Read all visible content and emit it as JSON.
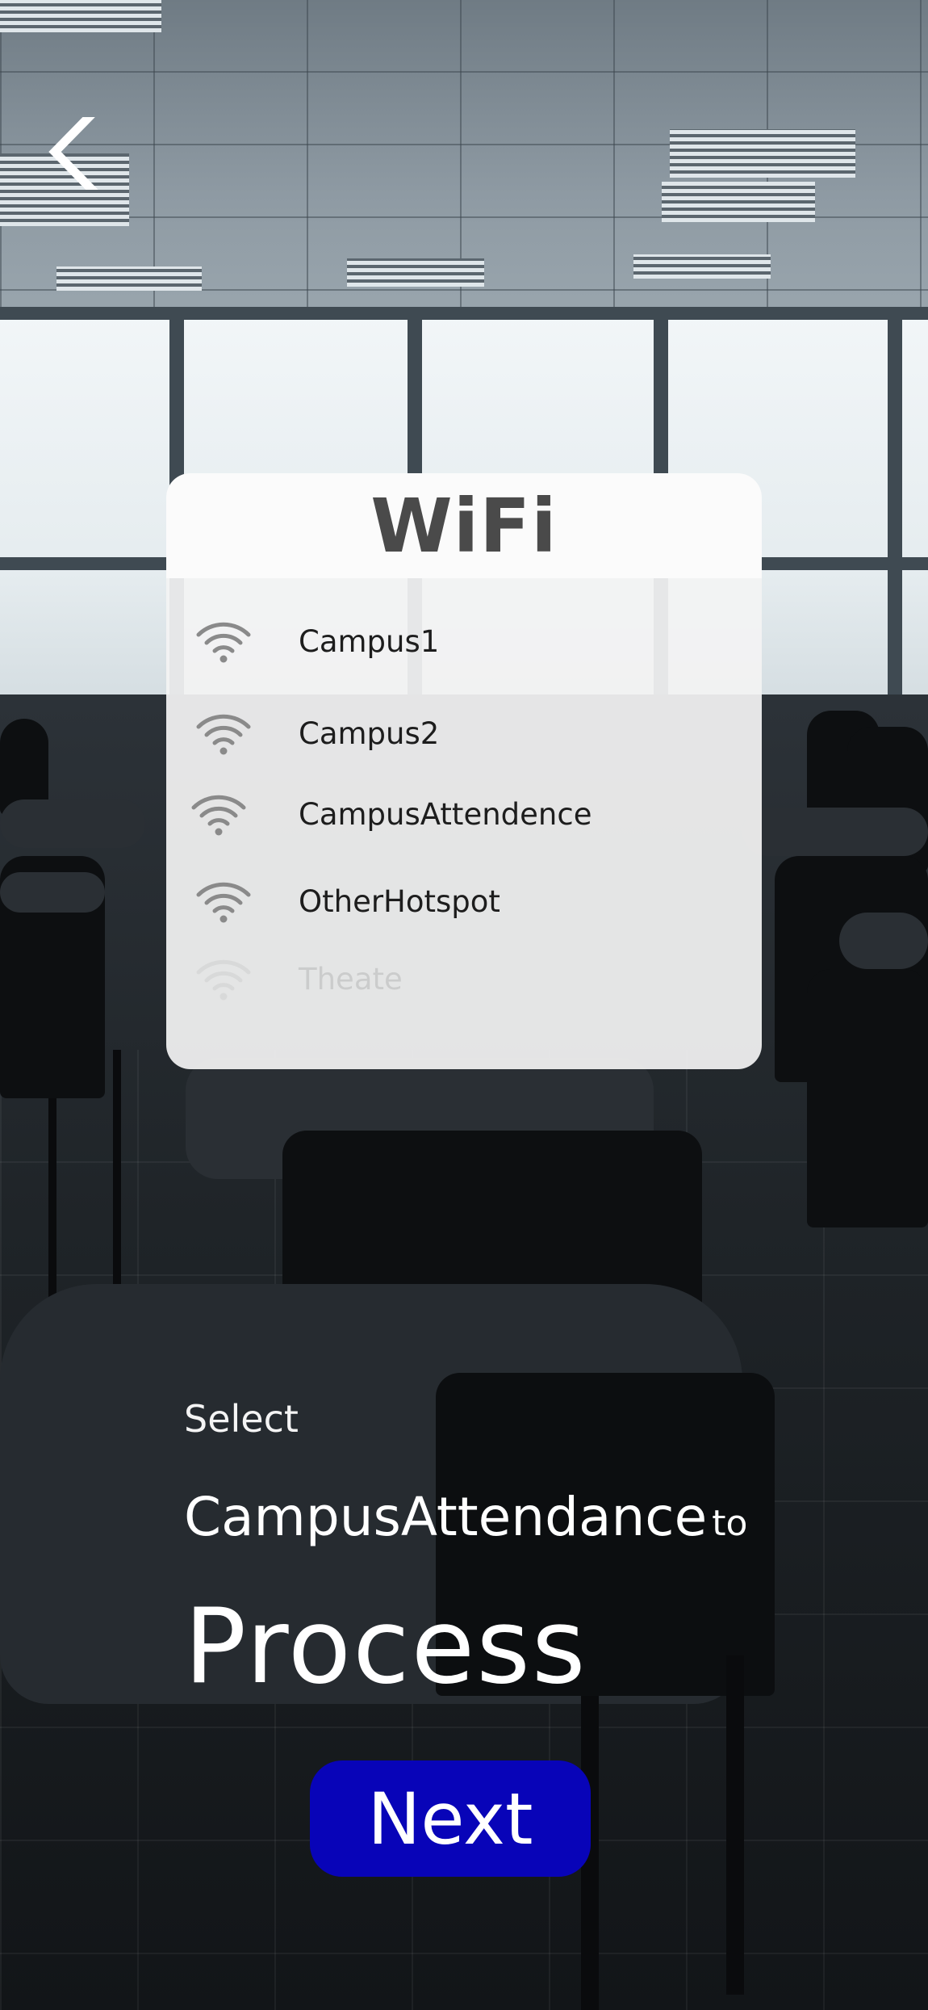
{
  "header": {
    "back_icon": "chevron-left-icon"
  },
  "wifi_card": {
    "title": "WiFi",
    "networks": [
      {
        "name": "Campus1",
        "icon": "wifi-icon"
      },
      {
        "name": "Campus2",
        "icon": "wifi-icon"
      },
      {
        "name": "CampusAttendence",
        "icon": "wifi-icon"
      },
      {
        "name": "OtherHotspot",
        "icon": "wifi-icon"
      },
      {
        "name": "Theate",
        "icon": "wifi-icon"
      }
    ]
  },
  "instruction": {
    "select": "Select",
    "network": "CampusAttendance",
    "to": "to",
    "action": "Process"
  },
  "actions": {
    "next_label": "Next"
  },
  "colors": {
    "next_button": "#0804b8",
    "card_background": "#f3f3f3",
    "wifi_icon": "#8a8a8a",
    "text_light": "#ffffff"
  }
}
